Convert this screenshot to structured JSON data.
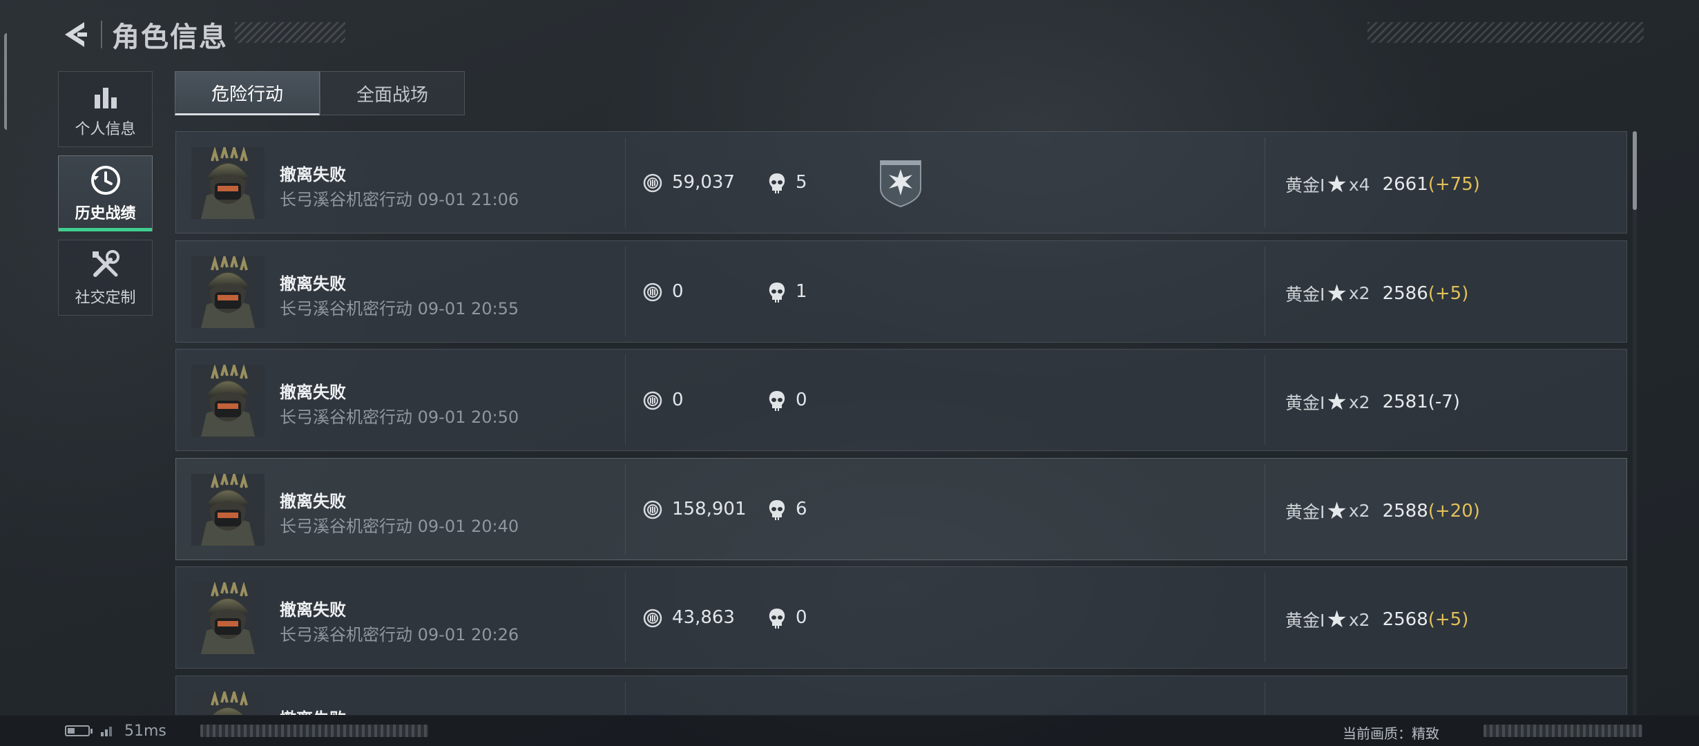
{
  "header": {
    "title": "角色信息"
  },
  "sidebar": {
    "items": [
      {
        "label": "个人信息",
        "icon": "bar-chart-icon",
        "active": false
      },
      {
        "label": "历史战绩",
        "icon": "history-clock-icon",
        "active": true
      },
      {
        "label": "社交定制",
        "icon": "wrench-screwdriver-icon",
        "active": false
      }
    ]
  },
  "tabs": [
    {
      "label": "危险行动",
      "active": true
    },
    {
      "label": "全面战场",
      "active": false
    }
  ],
  "records": [
    {
      "result": "撤离失败",
      "detail": "长弓溪谷机密行动 09-01 21:06",
      "value": "59,037",
      "kills": "5",
      "badge": true,
      "rank": "黄金I",
      "stars": "x4",
      "score": "2661",
      "delta": "(+75)"
    },
    {
      "result": "撤离失败",
      "detail": "长弓溪谷机密行动 09-01 20:55",
      "value": "0",
      "kills": "1",
      "badge": false,
      "rank": "黄金I",
      "stars": "x2",
      "score": "2586",
      "delta": "(+5)"
    },
    {
      "result": "撤离失败",
      "detail": "长弓溪谷机密行动 09-01 20:50",
      "value": "0",
      "kills": "0",
      "badge": false,
      "rank": "黄金I",
      "stars": "x2",
      "score": "2581",
      "delta": "(-7)"
    },
    {
      "result": "撤离失败",
      "detail": "长弓溪谷机密行动 09-01 20:40",
      "value": "158,901",
      "kills": "6",
      "badge": false,
      "rank": "黄金I",
      "stars": "x2",
      "score": "2588",
      "delta": "(+20)"
    },
    {
      "result": "撤离失败",
      "detail": "长弓溪谷机密行动 09-01 20:26",
      "value": "43,863",
      "kills": "0",
      "badge": false,
      "rank": "黄金I",
      "stars": "x2",
      "score": "2568",
      "delta": "(+5)"
    },
    {
      "result": "撤离失败",
      "detail": "",
      "value": "",
      "kills": "",
      "badge": false,
      "rank": "",
      "stars": "",
      "score": "",
      "delta": ""
    }
  ],
  "status": {
    "ping": "51ms",
    "quality_label": "当前画质：精致"
  },
  "colors": {
    "accent_green": "#3ecf8e",
    "delta_gold": "#e2c15a"
  }
}
